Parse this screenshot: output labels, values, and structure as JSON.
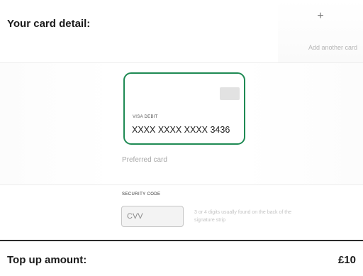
{
  "header": {
    "title": "Your card detail:",
    "add_card_icon": "plus-icon",
    "add_card_symbol": "+",
    "add_card_label": "Add another card"
  },
  "card": {
    "type_label": "VISA DEBIT",
    "number": "XXXX XXXX XXXX 3436",
    "preferred_label": "Preferred card",
    "border_color": "#1f8a54"
  },
  "security": {
    "label": "SECURITY CODE",
    "placeholder": "CVV",
    "hint": "3 or 4 digits usually found on the back of the signature strip"
  },
  "topup": {
    "label": "Top up amount:",
    "amount": "£10"
  }
}
